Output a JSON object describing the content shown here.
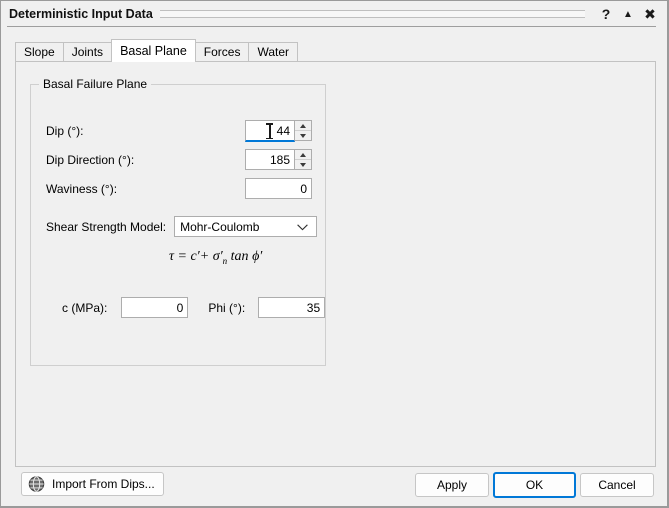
{
  "window": {
    "title": "Deterministic Input Data",
    "help_icon": "help-question-icon",
    "pin_icon": "collapse-up-icon",
    "close_icon": "close-icon"
  },
  "tabs": [
    {
      "label": "Slope",
      "active": false
    },
    {
      "label": "Joints",
      "active": false
    },
    {
      "label": "Basal Plane",
      "active": true
    },
    {
      "label": "Forces",
      "active": false
    },
    {
      "label": "Water",
      "active": false
    }
  ],
  "group": {
    "legend": "Basal Failure Plane",
    "fields": {
      "dip": {
        "label": "Dip (°):",
        "value": "44",
        "focused": true,
        "spinner": true
      },
      "dip_direction": {
        "label": "Dip Direction (°):",
        "value": "185",
        "focused": false,
        "spinner": true
      },
      "waviness": {
        "label": "Waviness (°):",
        "value": "0",
        "focused": false,
        "spinner": false
      }
    },
    "shear_strength": {
      "label": "Shear Strength Model:",
      "selected": "Mohr-Coulomb",
      "options": [
        "Mohr-Coulomb"
      ],
      "arrow_icon": "chevron-down-icon"
    },
    "equation": {
      "tau": "τ",
      "equals": "=",
      "cohesion": "c′",
      "plus": "+",
      "sigma": "σ′",
      "sigma_sub": "n",
      "tan": "tan",
      "phi": "ϕ′"
    },
    "strength_params": {
      "c": {
        "label": "c (MPa):",
        "value": "0"
      },
      "phi": {
        "label": "Phi (°):",
        "value": "35"
      }
    }
  },
  "footer": {
    "import": {
      "label": "Import From Dips...",
      "icon": "globe-sphere-icon"
    },
    "apply": "Apply",
    "ok": "OK",
    "cancel": "Cancel"
  },
  "colors": {
    "accent": "#0078d7",
    "window_bg": "#f0f0f0",
    "field_bg": "#ffffff",
    "border": "#adadad"
  }
}
